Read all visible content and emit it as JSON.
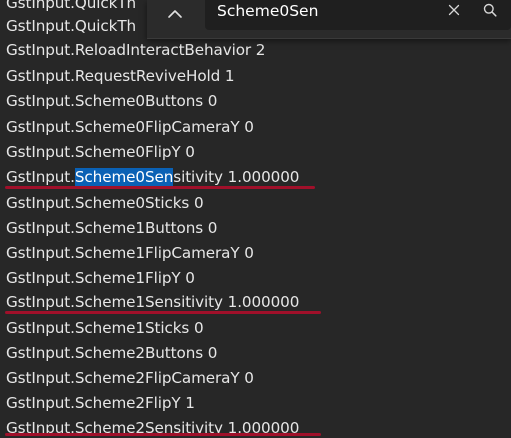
{
  "find": {
    "query": "Scheme0Sen",
    "toggle_icon": "chevron-up-icon",
    "clear_icon": "close-icon",
    "search_icon": "search-icon"
  },
  "lines": [
    "GstInput.QuickTh",
    "GstInput.QuickTh",
    "GstInput.ReloadInteractBehavior 2",
    "GstInput.RequestReviveHold 1",
    "GstInput.Scheme0Buttons 0",
    "GstInput.Scheme0FlipCameraY 0",
    "GstInput.Scheme0FlipY 0",
    "GstInput.Scheme0Sensitivity 1.000000",
    "GstInput.Scheme0Sticks 0",
    "GstInput.Scheme1Buttons 0",
    "GstInput.Scheme1FlipCameraY 0",
    "GstInput.Scheme1FlipY 0",
    "GstInput.Scheme1Sensitivity 1.000000",
    "GstInput.Scheme1Sticks 0",
    "GstInput.Scheme2Buttons 0",
    "GstInput.Scheme2FlipCameraY 0",
    "GstInput.Scheme2FlipY 1",
    "GstInput.Scheme2Sensitivity 1.000000"
  ],
  "match": {
    "line_prefix": "GstInput.",
    "text": "Scheme0Sen",
    "line_suffix": "sitivity 1.000000"
  },
  "colors": {
    "background": "#272727",
    "text": "#e6e6e6",
    "match_highlight": "#0a61b5",
    "squiggle": "#a0102a"
  }
}
